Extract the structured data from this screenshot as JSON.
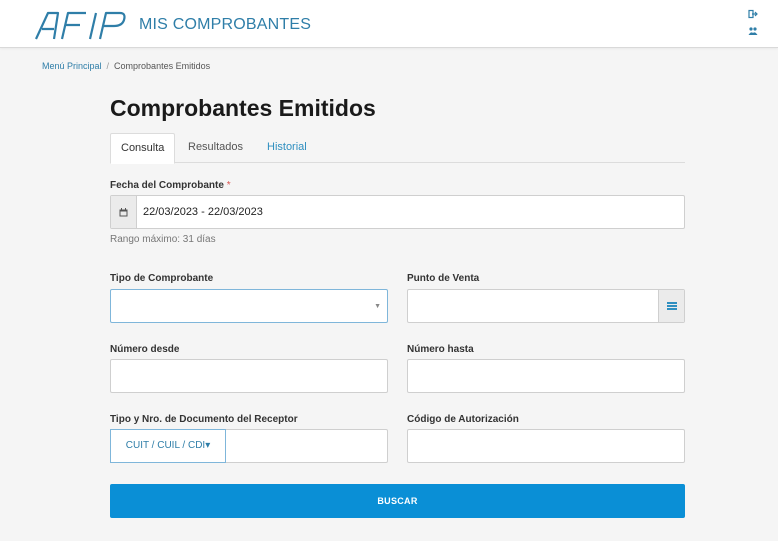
{
  "header": {
    "logo_text": "AFIP",
    "app_title": "MIS COMPROBANTES",
    "icons": [
      "logout-icon",
      "users-icon"
    ]
  },
  "breadcrumb": {
    "home": "Menú Principal",
    "separator": "/",
    "current": "Comprobantes Emitidos"
  },
  "page": {
    "title": "Comprobantes Emitidos"
  },
  "tabs": [
    {
      "label": "Consulta",
      "active": true
    },
    {
      "label": "Resultados",
      "active": false
    },
    {
      "label": "Historial",
      "active": false
    }
  ],
  "form": {
    "fecha": {
      "label": "Fecha del Comprobante",
      "required_mark": "*",
      "value": "22/03/2023 - 22/03/2023",
      "help": "Rango máximo: 31 días",
      "icon": "calendar-icon"
    },
    "tipo_comprobante": {
      "label": "Tipo de Comprobante",
      "value": ""
    },
    "punto_venta": {
      "label": "Punto de Venta",
      "value": "",
      "icon": "list-icon"
    },
    "numero_desde": {
      "label": "Número desde",
      "value": ""
    },
    "numero_hasta": {
      "label": "Número hasta",
      "value": ""
    },
    "doc_receptor": {
      "label": "Tipo y Nro. de Documento del Receptor",
      "type_label": "CUIT / CUIL / CDI",
      "caret": "▾",
      "value": ""
    },
    "codigo_autorizacion": {
      "label": "Código de Autorización",
      "value": ""
    },
    "submit_label": "BUSCAR"
  },
  "colors": {
    "brand": "#2f7ea8",
    "primary_button": "#0a8fd6",
    "required": "#d9534f"
  }
}
